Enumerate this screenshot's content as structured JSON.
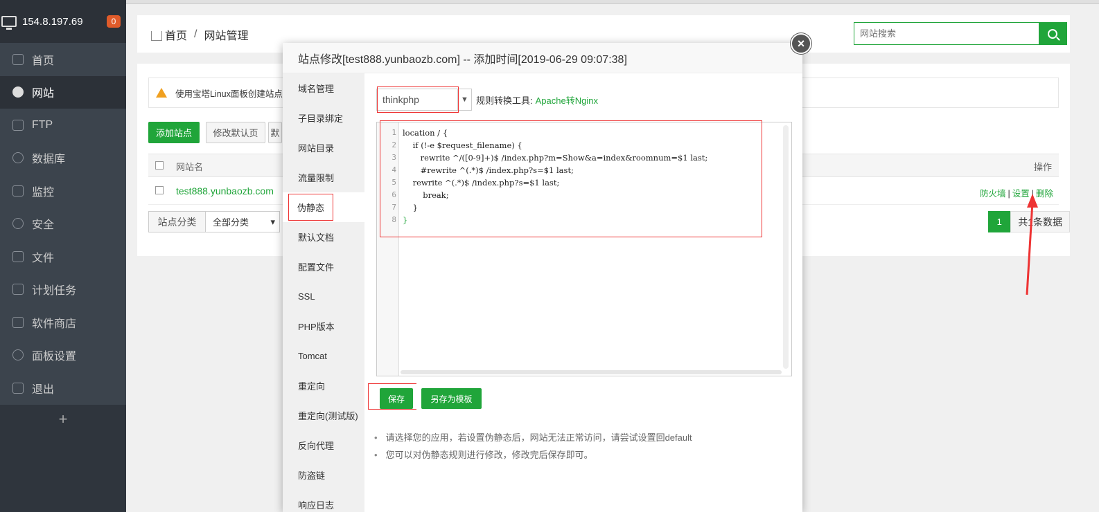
{
  "sidebar": {
    "ip": "154.8.197.69",
    "badge": "0",
    "items": [
      {
        "label": "首页",
        "icon": "home-icon"
      },
      {
        "label": "网站",
        "icon": "globe-icon"
      },
      {
        "label": "FTP",
        "icon": "ftp-icon"
      },
      {
        "label": "数据库",
        "icon": "database-icon"
      },
      {
        "label": "监控",
        "icon": "monitor-icon"
      },
      {
        "label": "安全",
        "icon": "shield-icon"
      },
      {
        "label": "文件",
        "icon": "folder-icon"
      },
      {
        "label": "计划任务",
        "icon": "calendar-icon"
      },
      {
        "label": "软件商店",
        "icon": "apps-icon"
      },
      {
        "label": "面板设置",
        "icon": "gear-icon"
      },
      {
        "label": "退出",
        "icon": "logout-icon"
      }
    ],
    "add": "+"
  },
  "breadcrumb": {
    "home": "首页",
    "sep": "/",
    "current": "网站管理"
  },
  "search": {
    "placeholder": "网站搜索"
  },
  "notice": "使用宝塔Linux面板创建站点",
  "toolbar": {
    "add_site": "添加站点",
    "modify_default": "修改默认页",
    "more": "默"
  },
  "table": {
    "col_name": "网站名",
    "col_ops": "操作",
    "rows": [
      {
        "name": "test888.yunbaozb.com",
        "op_firewall": "防火墙",
        "op_settings": "设置",
        "op_delete": "删除"
      }
    ]
  },
  "classify": {
    "label": "站点分类",
    "value": "全部分类"
  },
  "pager": {
    "page": "1",
    "total": "共1条数据"
  },
  "modal": {
    "title": "站点修改[test888.yunbaozb.com] -- 添加时间[2019-06-29 09:07:38]",
    "close": "×",
    "tabs": [
      "域名管理",
      "子目录绑定",
      "网站目录",
      "流量限制",
      "伪静态",
      "默认文档",
      "配置文件",
      "SSL",
      "PHP版本",
      "Tomcat",
      "重定向",
      "重定向(测试版)",
      "反向代理",
      "防盗链",
      "响应日志"
    ],
    "rewrite_select": "thinkphp",
    "convert_label": "规则转换工具:",
    "convert_link": "Apache转Nginx",
    "code_lines": [
      "location / {",
      "    if (!-e $request_filename) {",
      "       rewrite ^/([0-9]+)$ /index.php?m=Show&a=index&roomnum=$1 last;",
      "       #rewrite ^(.*)$ /index.php?s=$1 last;",
      "    rewrite ^(.*)$ /index.php?s=$1 last;",
      "        break;",
      "    }",
      "}"
    ],
    "save": "保存",
    "save_template": "另存为模板",
    "tips": [
      "请选择您的应用，若设置伪静态后，网站无法正常访问，请尝试设置回default",
      "您可以对伪静态规则进行修改，修改完后保存即可。"
    ]
  },
  "colors": {
    "accent": "#20a53a",
    "highlight": "#ee3333",
    "sidebar": "#3c444d"
  }
}
